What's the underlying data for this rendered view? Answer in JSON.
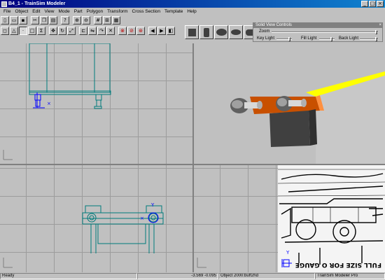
{
  "window": {
    "title": "B4_1 - TrainSim Modeler",
    "minimize": "_",
    "maximize": "□",
    "close": "×"
  },
  "menu": [
    "File",
    "Object",
    "Edit",
    "View",
    "Mode",
    "Part",
    "Polygon",
    "Transform",
    "Cross Section",
    "Template",
    "Help"
  ],
  "solid_view_controls": {
    "title": "Solid View Controls",
    "close": "×",
    "zoom_label": "Zoom",
    "key_light_label": "Key Light",
    "fill_light_label": "Fill Light",
    "back_light_label": "Back Light"
  },
  "viewports": {
    "axis_label_y": "Y",
    "reference_photo_text": "FULL SIZE FOR O GAUGE"
  },
  "status": {
    "state": "Ready",
    "coords": "-3.569  -0.095",
    "object": "Object 2000:buff2hd",
    "app": "TrainSim Modeler Pro"
  },
  "colors": {
    "titlebar": "#000080",
    "beam_orange": "#c85000",
    "beam_yellow": "#ffff00",
    "wireframe": "#007b7b",
    "selected": "#0000ff"
  }
}
